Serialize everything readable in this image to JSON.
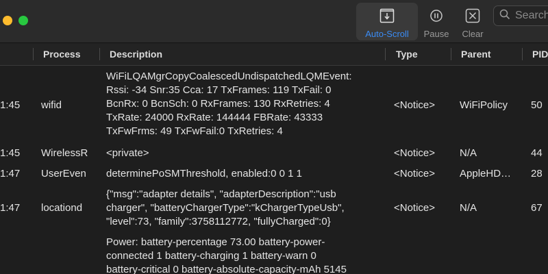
{
  "toolbar": {
    "autoscroll_label": "Auto-Scroll",
    "pause_label": "Pause",
    "clear_label": "Clear",
    "search_placeholder": "Search"
  },
  "columns": {
    "process": "Process",
    "description": "Description",
    "type": "Type",
    "parent": "Parent",
    "pid": "PID"
  },
  "rows": [
    {
      "time": "1:45",
      "process": "wifid",
      "description": "WiFiLQAMgrCopyCoalescedUndispatchedLQMEvent:\nRssi: -34 Snr:35 Cca: 17 TxFrames: 119 TxFail: 0\nBcnRx: 0 BcnSch: 0  RxFrames: 130 RxRetries: 4\nTxRate: 24000 RxRate: 144444 FBRate: 43333\nTxFwFrms: 49 TxFwFail:0 TxRetries: 4",
      "type": "<Notice>",
      "parent": "WiFiPolicy",
      "pid": "50"
    },
    {
      "time": "1:45",
      "process": "WirelessR",
      "description": "<private>",
      "type": "<Notice>",
      "parent": "N/A",
      "pid": "44"
    },
    {
      "time": "1:47",
      "process": "UserEven",
      "description": "determinePoSMThreshold, enabled:0 0 1 1",
      "type": "<Notice>",
      "parent": "AppleHD…",
      "pid": "28"
    },
    {
      "time": "1:47",
      "process": "locationd",
      "description": "{\"msg\":\"adapter details\", \"adapterDescription\":\"usb\ncharger\", \"batteryChargerType\":\"kChargerTypeUsb\",\n\"level\":73, \"family\":3758112772, \"fullyCharged\":0}",
      "type": "<Notice>",
      "parent": "N/A",
      "pid": "67"
    },
    {
      "time": "",
      "process": "",
      "description": "Power: battery-percentage 73.00 battery-power-\nconnected 1 battery-charging 1 battery-warn 0\nbattery-critical 0 battery-absolute-capacity-mAh 5145",
      "type": "",
      "parent": "",
      "pid": ""
    }
  ]
}
